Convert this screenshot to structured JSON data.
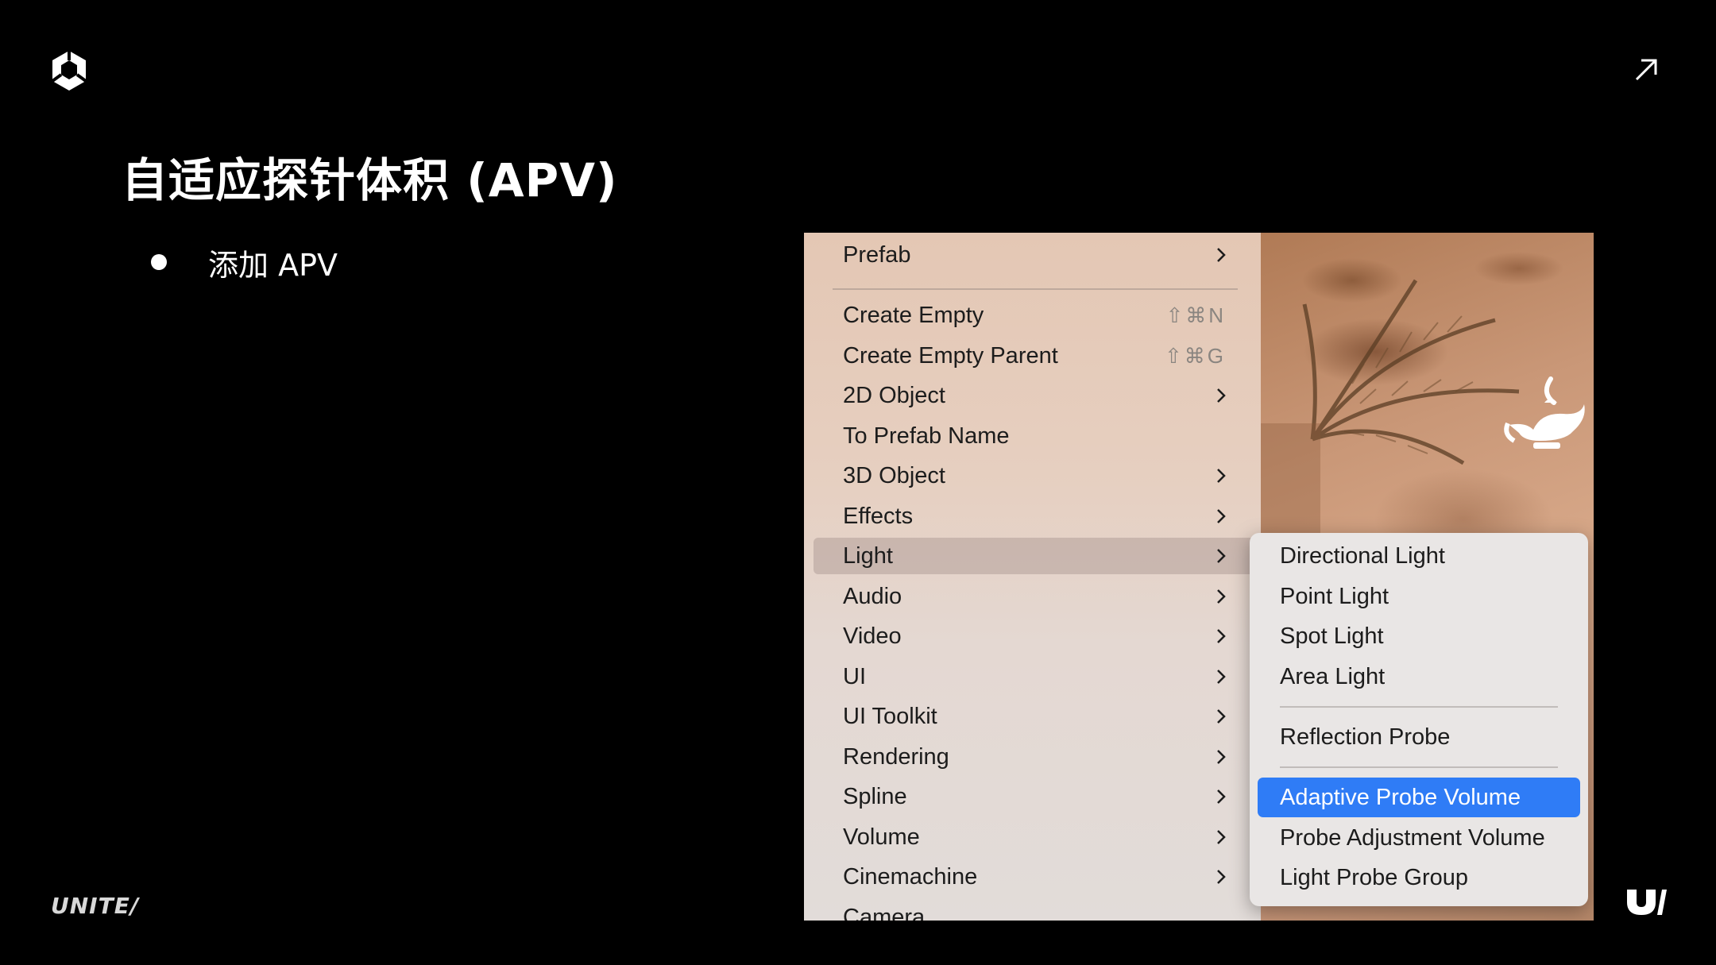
{
  "slide": {
    "title": "自适应探针体积 (APV)",
    "bullet": "添加 APV",
    "footer_brand": "UNITE/"
  },
  "menu": {
    "items": [
      {
        "label": "Prefab",
        "submenu": true
      },
      {
        "label": "Create Empty",
        "shortcut": "⇧⌘N"
      },
      {
        "label": "Create Empty Parent",
        "shortcut": "⇧⌘G"
      },
      {
        "label": "2D Object",
        "submenu": true
      },
      {
        "label": "To Prefab Name"
      },
      {
        "label": "3D Object",
        "submenu": true
      },
      {
        "label": "Effects",
        "submenu": true
      },
      {
        "label": "Light",
        "submenu": true,
        "highlighted": true
      },
      {
        "label": "Audio",
        "submenu": true
      },
      {
        "label": "Video",
        "submenu": true
      },
      {
        "label": "UI",
        "submenu": true
      },
      {
        "label": "UI Toolkit",
        "submenu": true
      },
      {
        "label": "Rendering",
        "submenu": true
      },
      {
        "label": "Spline",
        "submenu": true
      },
      {
        "label": "Volume",
        "submenu": true
      },
      {
        "label": "Cinemachine",
        "submenu": true
      },
      {
        "label": "Camera"
      }
    ]
  },
  "light_submenu": {
    "items": [
      {
        "label": "Directional Light"
      },
      {
        "label": "Point Light"
      },
      {
        "label": "Spot Light"
      },
      {
        "label": "Area Light"
      },
      {
        "label": "Reflection Probe"
      },
      {
        "label": "Adaptive Probe Volume",
        "selected": true
      },
      {
        "label": "Probe Adjustment Volume"
      },
      {
        "label": "Light Probe Group"
      }
    ]
  },
  "icons": [
    "unity-logo-icon",
    "expand-arrow-icon",
    "chevron-right-icon",
    "genie-lamp-icon",
    "unite-u-icon"
  ],
  "colors": {
    "background": "#000000",
    "selection": "#2f7cf6",
    "menu_text": "#1c1c1c"
  }
}
